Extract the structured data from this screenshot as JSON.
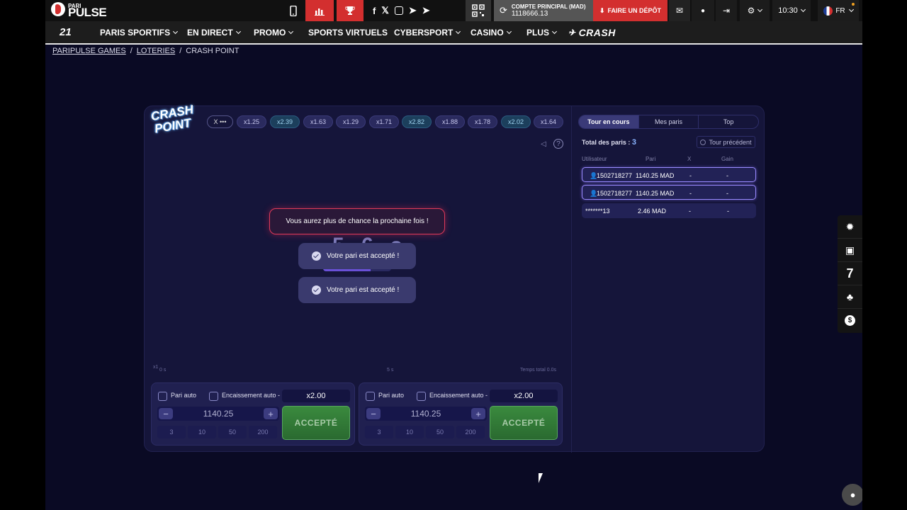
{
  "brand": {
    "small": "PARI",
    "big": "PULSE"
  },
  "topbar": {
    "account_label": "COMPTE PRINCIPAL (MAD)",
    "account_balance": "1118666.13",
    "deposit_label": "FAIRE UN DÉPÔT",
    "time": "10:30",
    "lang": "FR"
  },
  "nav": {
    "logo21": "21",
    "items": [
      "PARIS SPORTIFS",
      "EN DIRECT",
      "PROMO",
      "SPORTS VIRTUELS",
      "CYBERSPORT",
      "CASINO",
      "PLUS"
    ],
    "crash": "CRASH"
  },
  "breadcrumb": [
    "PARIPULSE GAMES",
    "LOTERIES",
    "CRASH POINT"
  ],
  "game": {
    "logo_line1": "CRASH",
    "logo_line2": "POINT",
    "history_first": "X •••",
    "history": [
      "x1.25",
      "x2.39",
      "x1.63",
      "x1.29",
      "x1.71",
      "x2.82",
      "x1.88",
      "x1.78",
      "x2.02",
      "x1.64"
    ],
    "lose_message": "Vous aurez plus de chance la prochaine fois !",
    "countdown": "5.6 s",
    "progress": 0.7,
    "toasts": [
      "Votre pari est accepté !",
      "Votre pari est accepté !"
    ],
    "axis_x1": "x1",
    "axis_0s": "0 s",
    "axis_5s": "5 s",
    "axis_total": "Temps total 0.0s"
  },
  "bets": [
    {
      "auto_bet": "Pari auto",
      "auto_cash": "Encaissement auto -",
      "multiplier": "x2.00",
      "stake": "1140.25",
      "quick": [
        "3",
        "10",
        "50",
        "200"
      ],
      "accept": "ACCEPTÉ"
    },
    {
      "auto_bet": "Pari auto",
      "auto_cash": "Encaissement auto -",
      "multiplier": "x2.00",
      "stake": "1140.25",
      "quick": [
        "3",
        "10",
        "50",
        "200"
      ],
      "accept": "ACCEPTÉ"
    }
  ],
  "side": {
    "tabs": [
      "Tour en cours",
      "Mes paris",
      "Top"
    ],
    "total_label": "Total des paris :",
    "total_value": "3",
    "prev_round": "Tour précédent",
    "headers": [
      "Utilisateur",
      "Pari",
      "X",
      "Gain"
    ],
    "rows": [
      {
        "user": "1502718277",
        "bet": "1140.25 MAD",
        "x": "-",
        "gain": "-"
      },
      {
        "user": "1502718277",
        "bet": "1140.25 MAD",
        "x": "-",
        "gain": "-"
      },
      {
        "user": "*******13",
        "bet": "2.46 MAD",
        "x": "-",
        "gain": "-"
      }
    ]
  },
  "right_sidebar": [
    "bug-icon",
    "gift-icon",
    "7",
    "tree-icon",
    "dollar-icon"
  ]
}
